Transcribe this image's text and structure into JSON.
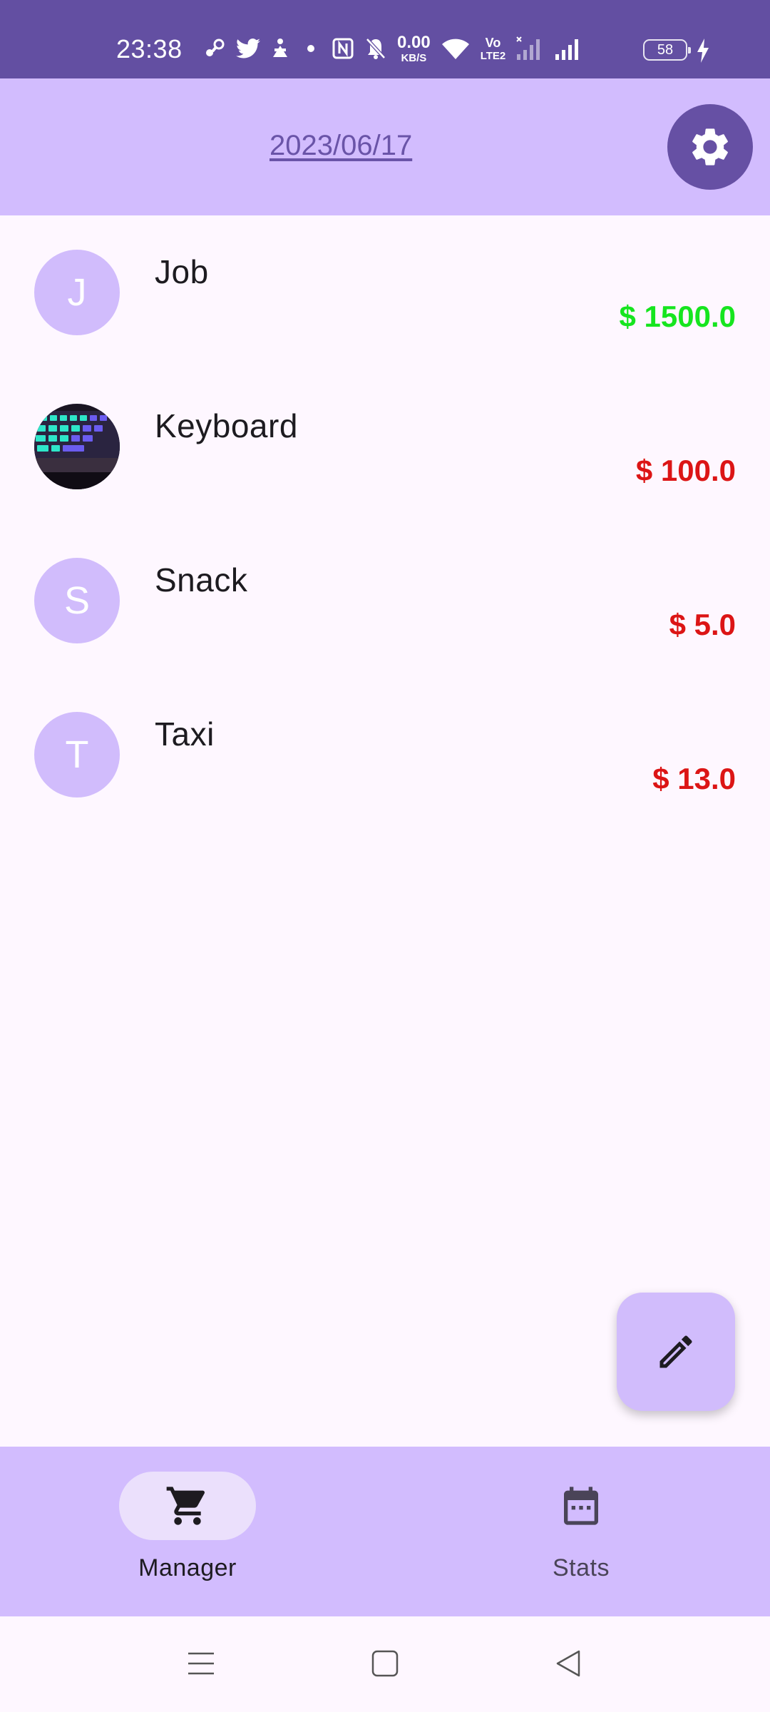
{
  "status_bar": {
    "time": "23:38",
    "net_speed_value": "0.00",
    "net_speed_unit": "KB/S",
    "volte_label": "Vo",
    "lte_label": "LTE2",
    "battery_level": "58",
    "icons": [
      "steam-icon",
      "twitter-icon",
      "app-icon",
      "dot-icon",
      "nfc-icon",
      "bell-muted-icon",
      "wifi-icon",
      "volte-icon",
      "signal-1-icon",
      "signal-2-icon",
      "battery-icon",
      "charging-icon"
    ]
  },
  "header": {
    "date": "2023/06/17",
    "settings_icon": "gear-icon"
  },
  "entries": [
    {
      "name": "Job",
      "amount": "$ 1500.0",
      "avatar_letter": "J",
      "type": "income"
    },
    {
      "name": "Keyboard",
      "amount": "$ 100.0",
      "avatar_letter": "",
      "avatar_image": "keyboard-photo",
      "type": "expense"
    },
    {
      "name": "Snack",
      "amount": "$ 5.0",
      "avatar_letter": "S",
      "type": "expense"
    },
    {
      "name": "Taxi",
      "amount": "$ 13.0",
      "avatar_letter": "T",
      "type": "expense"
    }
  ],
  "fab": {
    "icon": "pencil-icon"
  },
  "bottom_nav": {
    "items": [
      {
        "label": "Manager",
        "icon": "cart-icon",
        "selected": true
      },
      {
        "label": "Stats",
        "icon": "calendar-icon",
        "selected": false
      }
    ]
  },
  "system_nav": {
    "icons": [
      "menu-icon",
      "home-icon",
      "back-icon"
    ]
  },
  "colors": {
    "status_bar": "#634fa2",
    "header": "#d2bcfe",
    "background": "#fef7ff",
    "income": "#16e51f",
    "expense": "#dc1515",
    "accent": "#6650a4"
  }
}
